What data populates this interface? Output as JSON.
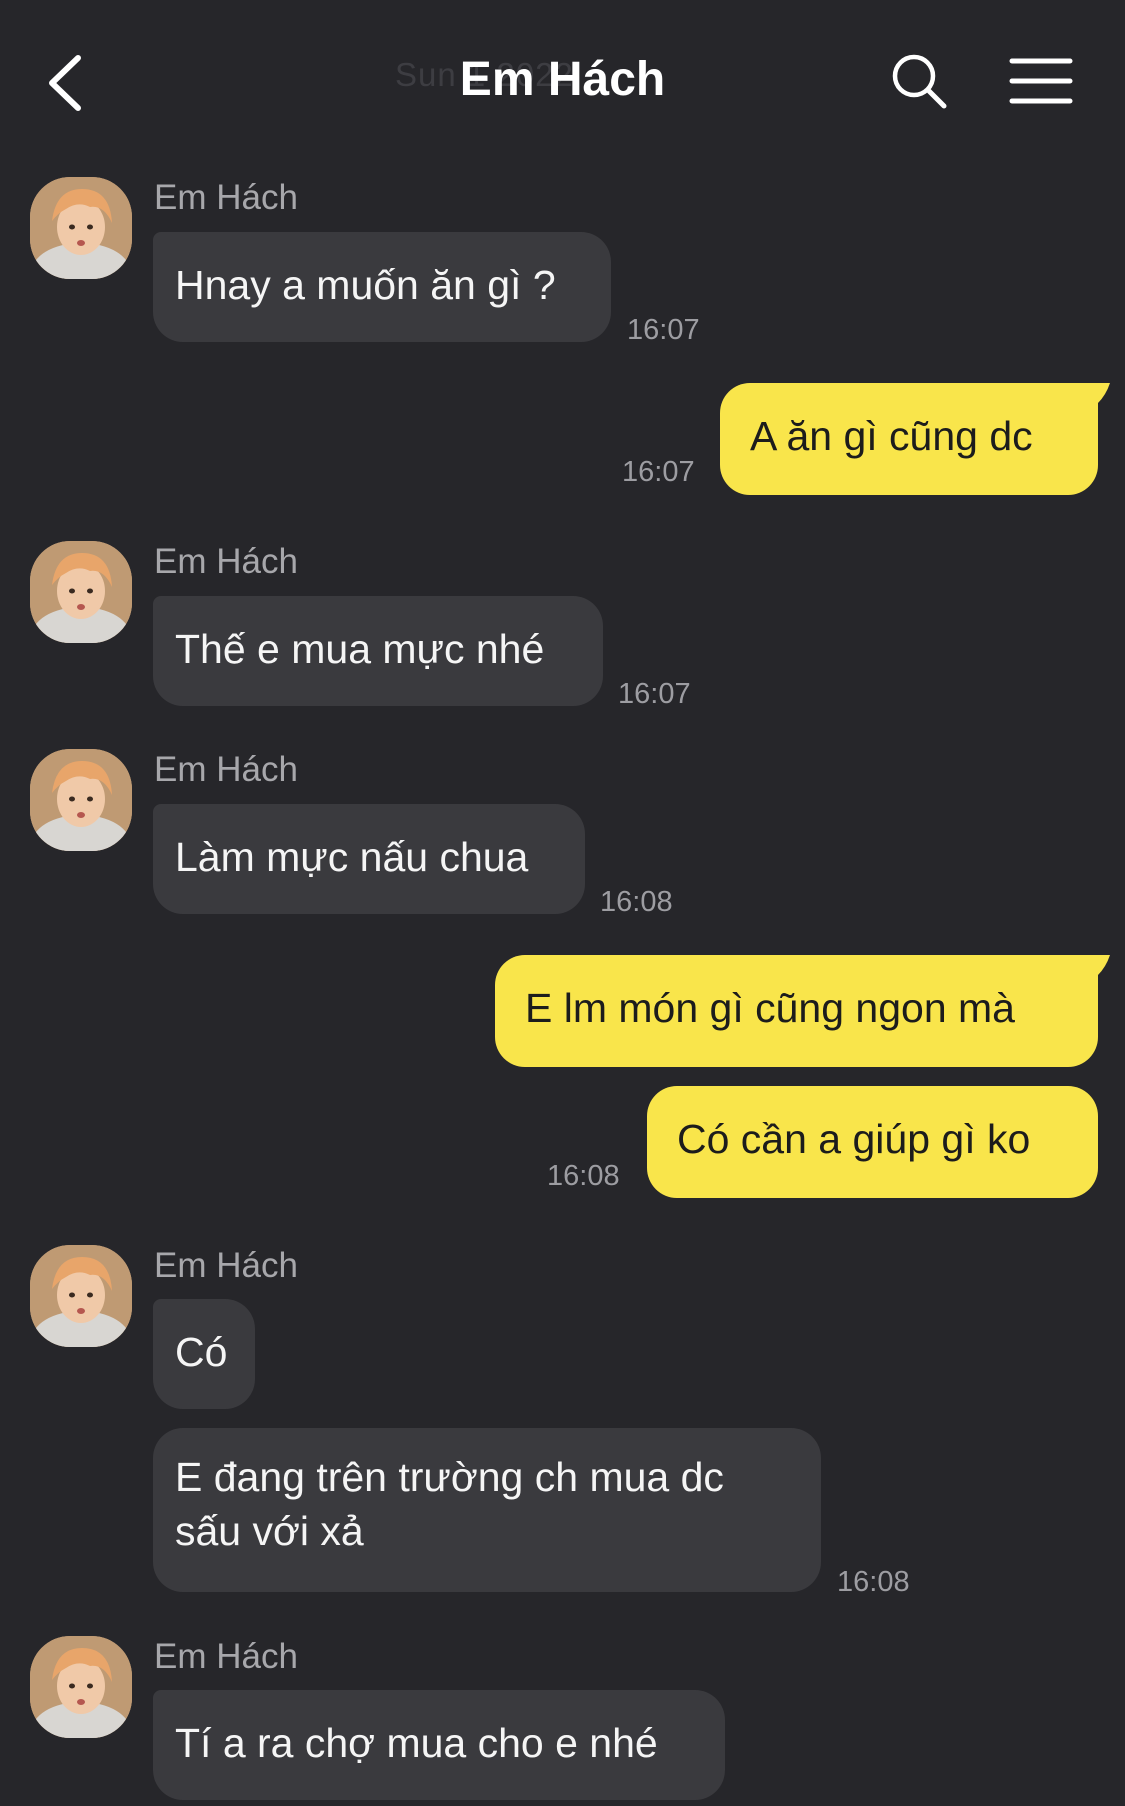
{
  "header": {
    "title": "Em Hách",
    "date_ghost": "Sun 1 2022",
    "back_icon": "chevron-left-icon",
    "search_icon": "search-icon",
    "menu_icon": "hamburger-menu-icon"
  },
  "colors": {
    "background": "#26262a",
    "incoming_bubble": "#3a3a3e",
    "outgoing_bubble": "#f9e54b",
    "timestamp": "#9d9da2",
    "sender_name": "#a7a7ab"
  },
  "messages": {
    "m1": {
      "sender": "Em Hách",
      "text": "Hnay a muốn ăn gì ?",
      "time": "16:07"
    },
    "m2": {
      "text": "A ăn gì cũng dc",
      "time": "16:07"
    },
    "m3": {
      "sender": "Em Hách",
      "text": "Thế e mua mực nhé",
      "time": "16:07"
    },
    "m4": {
      "sender": "Em Hách",
      "text": "Làm mực nấu chua",
      "time": "16:08"
    },
    "m5": {
      "text": "E lm món gì cũng ngon mà"
    },
    "m6": {
      "text": "Có cần a giúp gì ko",
      "time": "16:08"
    },
    "m7": {
      "sender": "Em Hách",
      "text": "Có"
    },
    "m8": {
      "text": "E đang trên trường ch mua dc sấu với xả",
      "time": "16:08"
    },
    "m9": {
      "sender": "Em Hách",
      "text": "Tí a ra chợ mua cho e nhé"
    }
  }
}
